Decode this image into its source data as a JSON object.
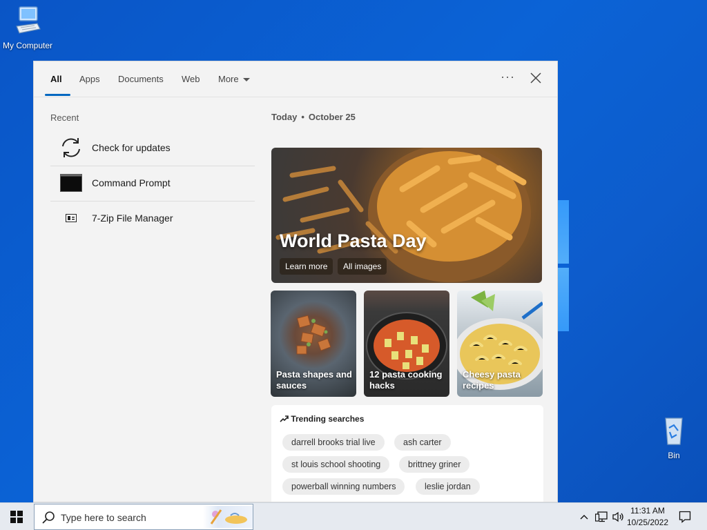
{
  "desktop": {
    "computer_label": "My Computer",
    "bin_label": "Bin"
  },
  "panel": {
    "tabs": [
      {
        "label": "All"
      },
      {
        "label": "Apps"
      },
      {
        "label": "Documents"
      },
      {
        "label": "Web"
      },
      {
        "label": "More"
      }
    ],
    "ellipsis": "···",
    "recent": {
      "title": "Recent",
      "items": [
        {
          "label": "Check for updates",
          "icon": "sync-icon"
        },
        {
          "label": "Command Prompt",
          "icon": "command-prompt-icon"
        },
        {
          "label": "7-Zip File Manager",
          "icon": "7zip-icon"
        }
      ]
    },
    "today": {
      "label": "Today",
      "date": "October 25"
    },
    "hero": {
      "title": "World Pasta Day",
      "learn_more": "Learn more",
      "all_images": "All images"
    },
    "cards": [
      {
        "caption": "Pasta shapes and sauces"
      },
      {
        "caption": "12 pasta cooking hacks"
      },
      {
        "caption": "Cheesy pasta recipes"
      }
    ],
    "trending": {
      "title": "Trending searches",
      "items": [
        "darrell brooks trial live",
        "ash carter",
        "st louis school shooting",
        "brittney griner",
        "powerball winning numbers",
        "leslie jordan"
      ]
    }
  },
  "taskbar": {
    "search_placeholder": "Type here to search",
    "time": "11:31 AM",
    "date": "10/25/2022"
  },
  "colors": {
    "accent": "#0067c0",
    "desktop": "#0b63d6"
  }
}
